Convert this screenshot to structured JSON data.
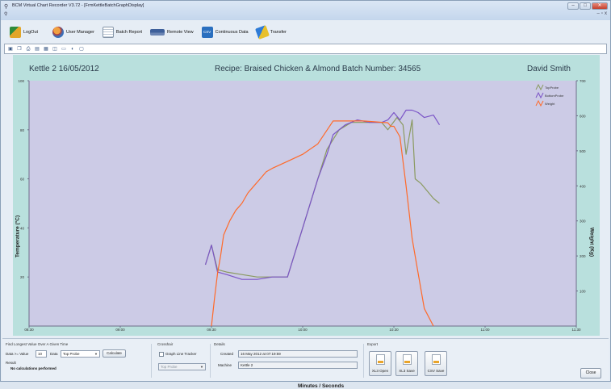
{
  "window": {
    "title": "BCM Virtual Chart Recorder V3.72 - [FrmKettleBatchGraphDisplay]",
    "controls": [
      "–",
      "□",
      "✕"
    ],
    "mdi_controls": [
      "–",
      "▫",
      "x"
    ]
  },
  "toolbar": {
    "items": [
      {
        "label": "LogOut",
        "icon": "logout-icon"
      },
      {
        "label": "User Manager",
        "icon": "users-icon"
      },
      {
        "label": "Batch Report",
        "icon": "report-icon"
      },
      {
        "label": "Remote View",
        "icon": "remote-view-icon"
      },
      {
        "label": "Continuous Data",
        "icon": "csv-data-icon",
        "icon_text": "CSV"
      },
      {
        "label": "Transfer",
        "icon": "transfer-icon"
      }
    ]
  },
  "iconstrip": [
    "save-icon",
    "copy-icon",
    "print-icon",
    "chart-icon",
    "grid-icon",
    "line-chart-icon",
    "zoom-icon",
    "pointer-icon",
    "select-icon"
  ],
  "header": {
    "kettle": "Kettle 2   16/05/2012",
    "recipe": "Recipe: Braised Chicken & Almond  Batch Number: 34565",
    "user": "David Smith"
  },
  "chart_data": {
    "type": "line",
    "title": "",
    "xlabel": "Minutes / Seconds",
    "ylabel": "Temperature (°C)",
    "y2label": "Weight (Kg)",
    "x_ticks": [
      "08:30",
      "09:00",
      "09:30",
      "10:00",
      "10:30",
      "11:00",
      "11:30"
    ],
    "y_ticks": [
      "100",
      "80",
      "60",
      "40",
      "20"
    ],
    "y2_ticks": [
      "700",
      "600",
      "500",
      "400",
      "300",
      "200",
      "100"
    ],
    "xlim_minutes": [
      0,
      180
    ],
    "ylim": [
      0,
      100
    ],
    "y2lim": [
      0,
      700
    ],
    "legend_position": "top-right",
    "series": [
      {
        "name": "TopProbe",
        "color": "#8a9a60",
        "axis": "left",
        "x": [
          58,
          60,
          62,
          65,
          70,
          75,
          80,
          85,
          90,
          95,
          98,
          102,
          106,
          110,
          113,
          116,
          118,
          121,
          123,
          124,
          126,
          127,
          129,
          131,
          133,
          135
        ],
        "y": [
          25,
          33,
          23,
          22,
          21,
          20,
          20,
          20,
          40,
          60,
          72,
          80,
          83,
          83,
          83,
          83,
          80,
          85,
          82,
          70,
          84,
          60,
          58,
          55,
          52,
          50
        ]
      },
      {
        "name": "BottomProbe",
        "color": "#7b55c7",
        "axis": "left",
        "x": [
          58,
          60,
          62,
          65,
          70,
          75,
          80,
          85,
          90,
          95,
          98,
          100,
          104,
          108,
          112,
          116,
          118,
          120,
          122,
          124,
          126,
          128,
          130,
          133,
          135
        ],
        "y": [
          25,
          33,
          22,
          21,
          19,
          19,
          20,
          20,
          40,
          60,
          70,
          78,
          82,
          84,
          83,
          83,
          84,
          87,
          84,
          88,
          88,
          87,
          85,
          86,
          82
        ]
      },
      {
        "name": "Weight",
        "color": "#ff6a2a",
        "axis": "right",
        "x": [
          60,
          61,
          62,
          63,
          64,
          66,
          68,
          70,
          72,
          74,
          76,
          78,
          80,
          85,
          90,
          95,
          100,
          110,
          118,
          119,
          120,
          122,
          124,
          126,
          128,
          130,
          133
        ],
        "y": [
          0,
          80,
          150,
          200,
          260,
          300,
          330,
          350,
          380,
          400,
          420,
          440,
          450,
          470,
          490,
          520,
          585,
          585,
          580,
          570,
          570,
          540,
          400,
          250,
          150,
          50,
          0
        ]
      }
    ]
  },
  "bottom": {
    "find": {
      "title": "Find Longest Value Over A Given Time",
      "data_label": "Data >= Value",
      "value": "10",
      "date_label": "Data",
      "probe_value": "Top Probe",
      "calculate_label": "Calculate",
      "result_label": "Result",
      "result_text": "No calculations performed"
    },
    "crosshair": {
      "title": "Crosshair",
      "tracker_label": "Graph Line Tracker",
      "probe_value": "Top Probe"
    },
    "details": {
      "title": "Details",
      "created_label": "Created",
      "created_value": "16 May 2012 at 07:19:59",
      "machine_label": "Machine",
      "machine_value": "Kettle 2"
    },
    "export": {
      "title": "Export",
      "buttons": [
        "XL3 Open",
        "XL3 Save",
        "CSV Save"
      ]
    },
    "close_label": "Close"
  }
}
